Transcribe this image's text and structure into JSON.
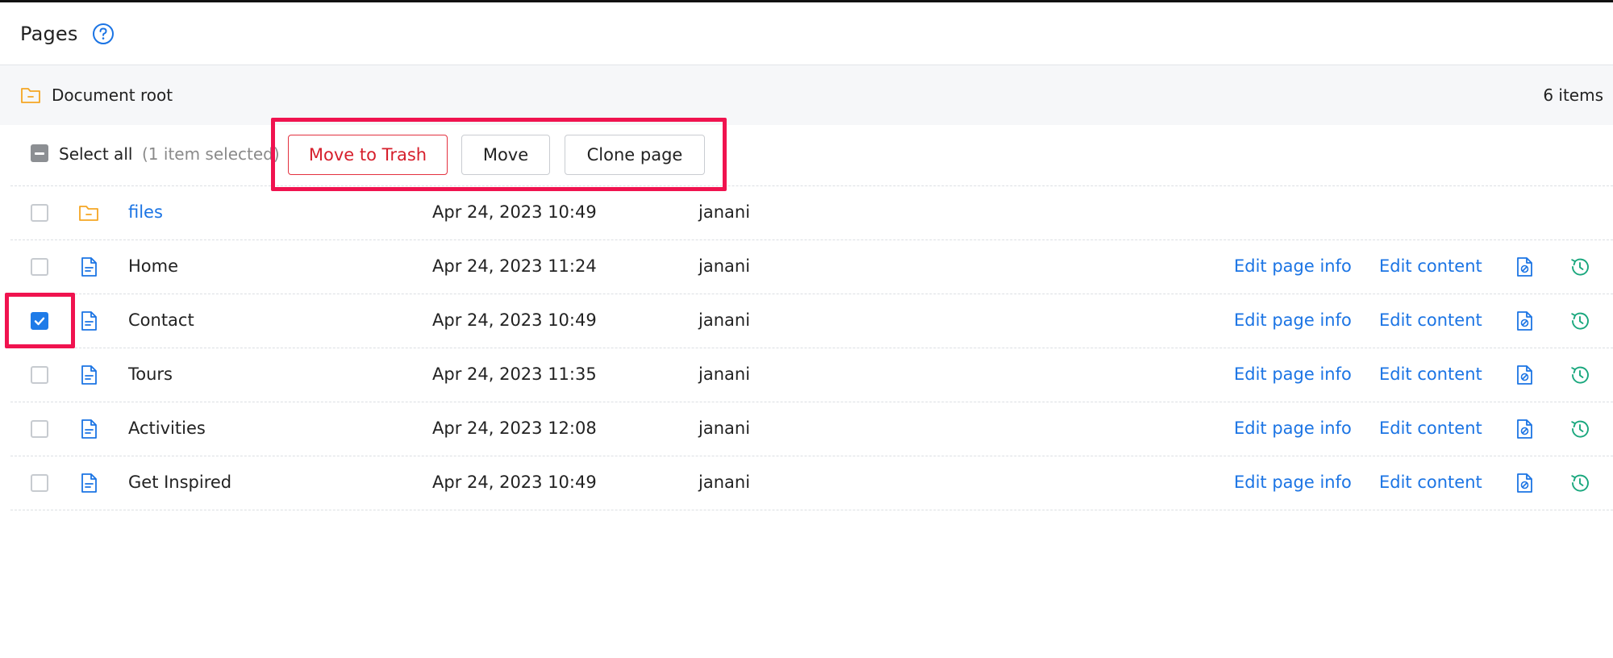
{
  "header": {
    "title": "Pages"
  },
  "breadcrumb": {
    "label": "Document root",
    "count": "6 items"
  },
  "toolbar": {
    "select_all": "Select all",
    "selected_count": "(1 item selected)",
    "move_to_trash": "Move to Trash",
    "move": "Move",
    "clone_page": "Clone page"
  },
  "actions": {
    "edit_page_info": "Edit page info",
    "edit_content": "Edit content"
  },
  "rows": [
    {
      "name": "files",
      "date": "Apr 24, 2023 10:49",
      "author": "janani",
      "type": "folder",
      "checked": false
    },
    {
      "name": "Home",
      "date": "Apr 24, 2023 11:24",
      "author": "janani",
      "type": "page",
      "checked": false
    },
    {
      "name": "Contact",
      "date": "Apr 24, 2023 10:49",
      "author": "janani",
      "type": "page",
      "checked": true
    },
    {
      "name": "Tours",
      "date": "Apr 24, 2023 11:35",
      "author": "janani",
      "type": "page",
      "checked": false
    },
    {
      "name": "Activities",
      "date": "Apr 24, 2023 12:08",
      "author": "janani",
      "type": "page",
      "checked": false
    },
    {
      "name": "Get Inspired",
      "date": "Apr 24, 2023 10:49",
      "author": "janani",
      "type": "page",
      "checked": false
    }
  ],
  "colors": {
    "accent_blue": "#1b74e4",
    "checkbox_blue": "#1e7be8",
    "trash_red": "#d61f2c",
    "highlight": "#f0134f",
    "folder_orange": "#f5a623",
    "history_green": "#19a77d"
  },
  "icons": {
    "help": "help-circle-icon",
    "folder": "folder-icon",
    "page": "file-text-icon",
    "seo": "file-settings-icon",
    "history": "history-icon"
  }
}
